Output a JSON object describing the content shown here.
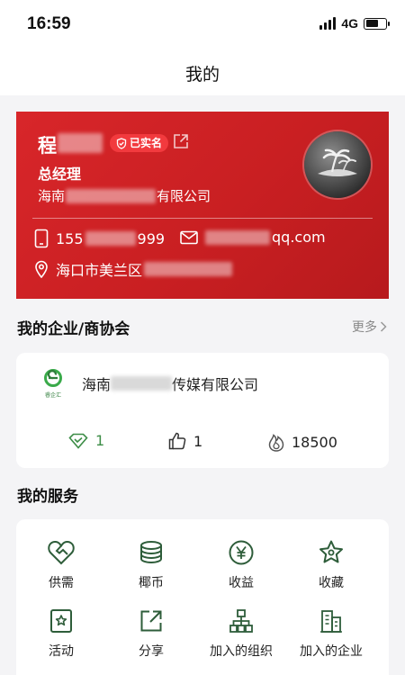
{
  "status": {
    "time": "16:59",
    "network": "4G",
    "battery_level": 0.65
  },
  "nav": {
    "title": "我的"
  },
  "card": {
    "name": "程",
    "verified_label": "已实名",
    "position": "总经理",
    "company_prefix": "海南",
    "company_suffix": "有限公司",
    "phone_prefix": "155",
    "phone_suffix": "999",
    "email_suffix": "qq.com",
    "address_prefix": "海口市美兰区"
  },
  "enterprise": {
    "section_title": "我的企业/商协会",
    "more_label": "更多",
    "name_prefix": "海南",
    "name_suffix": "传媒有限公司",
    "logo_text": "睿企汇",
    "stats": {
      "certified": "1",
      "likes": "1",
      "heat": "18500"
    }
  },
  "services": {
    "section_title": "我的服务",
    "items": [
      {
        "label": "供需",
        "icon": "handshake-heart-icon"
      },
      {
        "label": "椰币",
        "icon": "coin-stack-icon"
      },
      {
        "label": "收益",
        "icon": "yuan-circle-icon"
      },
      {
        "label": "收藏",
        "icon": "star-icon"
      },
      {
        "label": "活动",
        "icon": "activity-badge-icon"
      },
      {
        "label": "分享",
        "icon": "share-icon"
      },
      {
        "label": "加入的组织",
        "icon": "org-chart-icon"
      },
      {
        "label": "加入的企业",
        "icon": "building-icon"
      }
    ]
  },
  "colors": {
    "brand_red": "#c91f22",
    "accent_green": "#3d8d47",
    "icon_green": "#2e5d3a"
  }
}
